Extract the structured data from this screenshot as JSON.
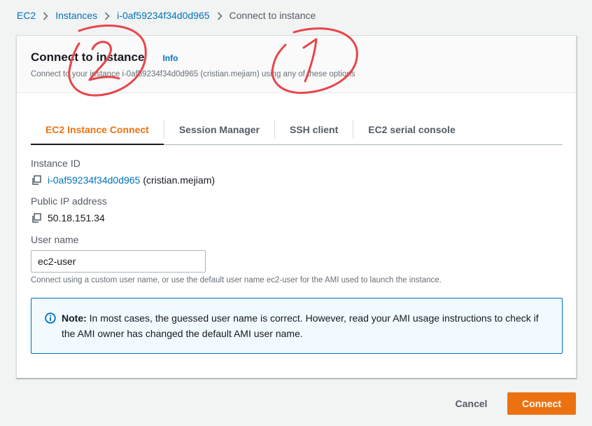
{
  "breadcrumb": {
    "items": [
      {
        "label": "EC2"
      },
      {
        "label": "Instances"
      },
      {
        "label": "i-0af59234f34d0d965"
      },
      {
        "label": "Connect to instance"
      }
    ]
  },
  "header": {
    "title": "Connect to instance",
    "info_label": "Info",
    "description": "Connect to your instance i-0af59234f34d0d965 (cristian.mejiam) using any of these options"
  },
  "tabs": [
    {
      "label": "EC2 Instance Connect",
      "active": true
    },
    {
      "label": "Session Manager",
      "active": false
    },
    {
      "label": "SSH client",
      "active": false
    },
    {
      "label": "EC2 serial console",
      "active": false
    }
  ],
  "instance": {
    "id_label": "Instance ID",
    "id_value": "i-0af59234f34d0d965",
    "id_owner": "(cristian.mejiam)",
    "ip_label": "Public IP address",
    "ip_value": "50.18.151.34"
  },
  "username": {
    "label": "User name",
    "value": "ec2-user",
    "hint": "Connect using a custom user name, or use the default user name ec2-user for the AMI used to launch the instance."
  },
  "note": {
    "title": "Note:",
    "text": "In most cases, the guessed user name is correct. However, read your AMI usage instructions to check if the AMI owner has changed the default AMI user name."
  },
  "actions": {
    "cancel_label": "Cancel",
    "connect_label": "Connect"
  },
  "annotations": {
    "color": "#e8454a",
    "marks": [
      "2",
      "1"
    ]
  },
  "colors": {
    "accent": "#ec7211",
    "link": "#0073bb",
    "info_bg": "#f1faff"
  },
  "icons": {
    "copy": "copy-icon",
    "info": "info-circle-icon",
    "separator": "chevron-right-icon"
  }
}
